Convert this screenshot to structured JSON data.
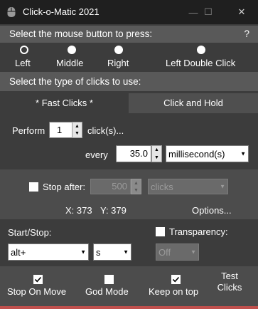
{
  "window": {
    "title": "Click-o-Matic 2021",
    "controls": {
      "minimize": "—",
      "maximize": "☐",
      "close": "✕"
    }
  },
  "mouse_section": {
    "header": "Select the mouse button to press:",
    "help": "?",
    "options": [
      "Left",
      "Middle",
      "Right",
      "Left Double Click"
    ],
    "selected": "Left"
  },
  "click_type_section": {
    "header": "Select the type of clicks to use:",
    "tabs": [
      "* Fast Clicks *",
      "Click and Hold"
    ],
    "active_tab": "* Fast Clicks *"
  },
  "fast_clicks": {
    "perform_label": "Perform",
    "count_value": "1",
    "clicks_suffix": "click(s)...",
    "every_label": "every",
    "interval_value": "35.0",
    "unit_value": "millisecond(s)"
  },
  "stop_after": {
    "label": "Stop after:",
    "checked": false,
    "value": "500",
    "unit": "clicks"
  },
  "coords": {
    "x": "X: 373",
    "y": "Y: 379"
  },
  "options_link": "Options...",
  "hotkey": {
    "label": "Start/Stop:",
    "modifier": "alt+",
    "key": "s"
  },
  "transparency": {
    "label": "Transparency:",
    "checked": false,
    "value": "Off"
  },
  "bottom": {
    "stop_on_move": "Stop On Move",
    "god_mode": "God Mode",
    "keep_on_top": "Keep on top",
    "test_clicks_line1": "Test",
    "test_clicks_line2": "Clicks",
    "stop_on_move_checked": true,
    "god_mode_checked": false,
    "keep_on_top_checked": true
  },
  "colors": {
    "background": "#3c3c3c",
    "titlebar": "#1f1f1f",
    "section_header": "#595959",
    "active_tab": "#3c3c3c",
    "inactive_tab": "#4f4f4f",
    "bottom_accent": "#c0504d"
  }
}
